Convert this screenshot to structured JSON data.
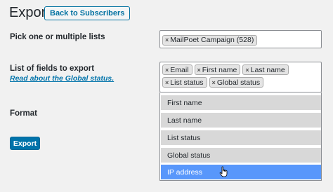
{
  "header": {
    "title": "Export",
    "back_label": "Back to Subscribers"
  },
  "lists": {
    "label": "Pick one or multiple lists",
    "selected": [
      "MailPoet Campaign (528)"
    ]
  },
  "fields": {
    "label": "List of fields to export",
    "link": "Read about the Global status.",
    "selected": [
      "Email",
      "First name",
      "Last name",
      "List status",
      "Global status"
    ],
    "options": [
      "First name",
      "Last name",
      "List status",
      "Global status",
      "IP address"
    ],
    "highlighted": "IP address"
  },
  "format": {
    "label": "Format"
  },
  "export_button": "Export",
  "colors": {
    "primary": "#0073aa",
    "highlight": "#5897fb",
    "option_bg": "#d8d8d8"
  }
}
